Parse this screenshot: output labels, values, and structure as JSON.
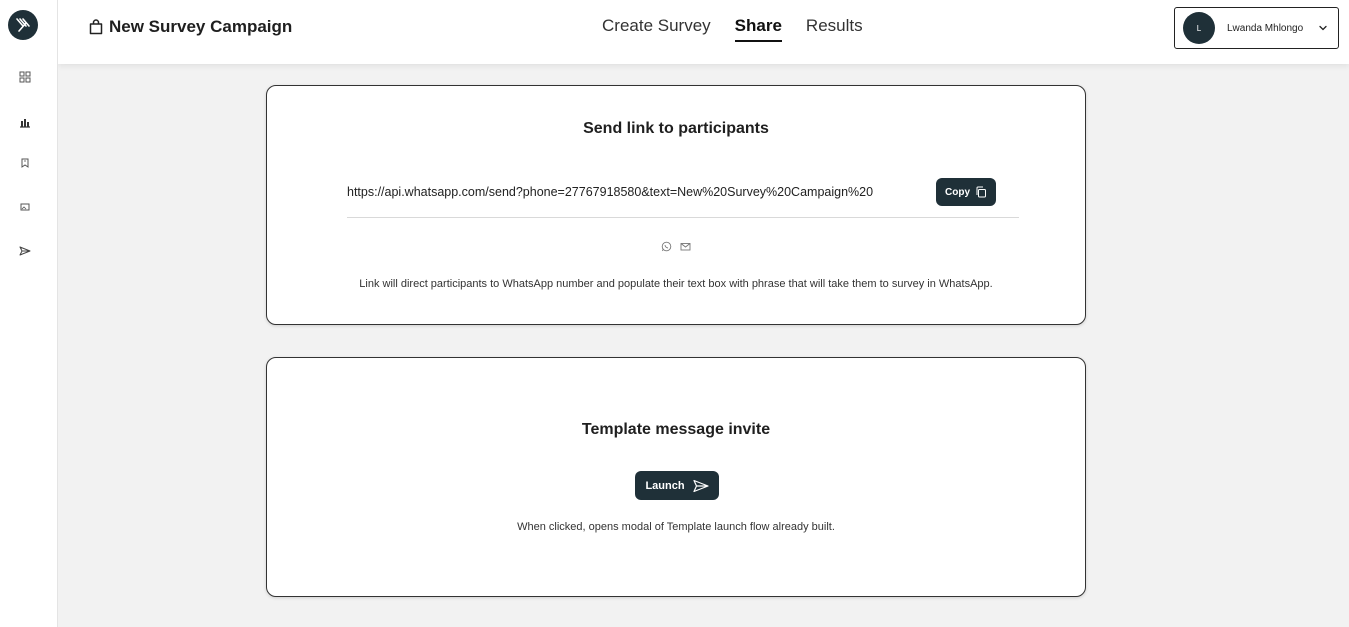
{
  "sidebar": {
    "logo_icon": "brand-logo",
    "items": [
      {
        "icon": "dashboard-grid-icon"
      },
      {
        "icon": "bar-chart-icon"
      },
      {
        "icon": "book-icon"
      },
      {
        "icon": "image-icon"
      },
      {
        "icon": "send-icon"
      }
    ]
  },
  "header": {
    "title": "New Survey Campaign",
    "title_icon": "shopping-bag-icon",
    "tabs": [
      {
        "label": "Create Survey",
        "active": false
      },
      {
        "label": "Share",
        "active": true
      },
      {
        "label": "Results",
        "active": false
      }
    ],
    "user": {
      "initial": "L",
      "name": "Lwanda Mhlongo"
    }
  },
  "send_link_card": {
    "title": "Send link to participants",
    "link": "https://api.whatsapp.com/send?phone=27767918580&text=New%20Survey%20Campaign%20",
    "copy_label": "Copy",
    "share_icons": [
      "whatsapp-icon",
      "mail-icon"
    ],
    "description": "Link will direct participants to WhatsApp number and populate their text box with phrase that will take them to survey in WhatsApp."
  },
  "template_card": {
    "title": "Template message invite",
    "launch_label": "Launch",
    "description": "When clicked, opens modal of Template launch flow already built."
  },
  "colors": {
    "accent": "#1f3038",
    "background": "#f2f2f2"
  }
}
